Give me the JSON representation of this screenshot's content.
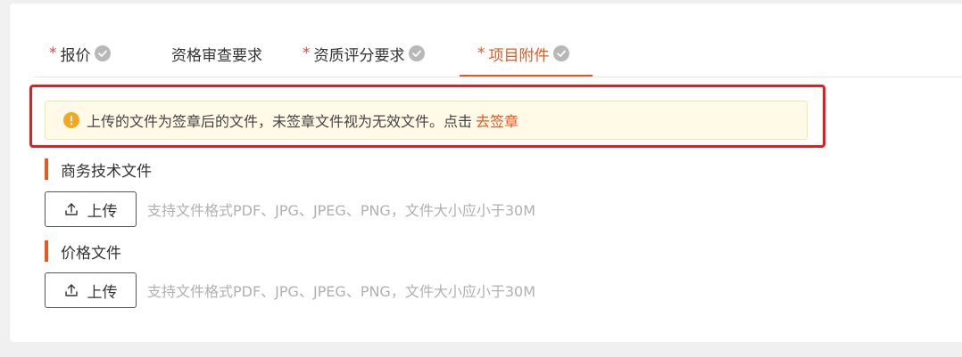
{
  "tabs": [
    {
      "required": "*",
      "label": "报价",
      "done": true
    },
    {
      "required": "",
      "label": "资格审查要求",
      "done": false
    },
    {
      "required": "*",
      "label": "资质评分要求",
      "done": true
    },
    {
      "required": "*",
      "label": "项目附件",
      "done": true,
      "active": true
    }
  ],
  "notice": {
    "text": "上传的文件为签章后的文件，未签章文件视为无效文件。点击",
    "link": "去签章"
  },
  "sections": [
    {
      "title": "商务技术文件",
      "upload_label": "上传",
      "hint": "支持文件格式PDF、JPG、JPEG、PNG，文件大小应小于30M"
    },
    {
      "title": "价格文件",
      "upload_label": "上传",
      "hint": "支持文件格式PDF、JPG、JPEG、PNG，文件大小应小于30M"
    }
  ],
  "colors": {
    "accent": "#e8581f",
    "required": "#e94242",
    "check": "#b8b8b8",
    "warning": "#f5a623",
    "highlight": "#e02020"
  }
}
